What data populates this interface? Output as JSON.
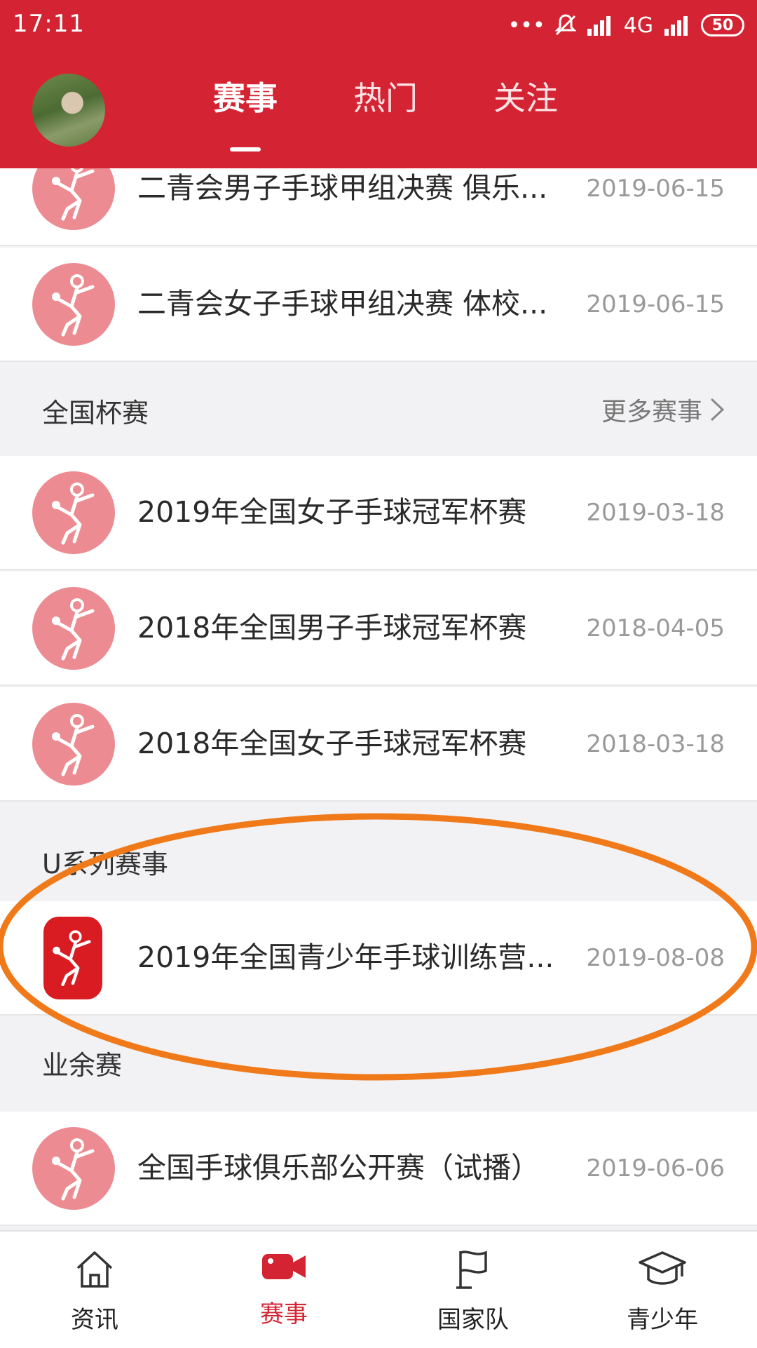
{
  "status_bar": {
    "time": "17:11",
    "network": "4G",
    "battery": "50"
  },
  "header": {
    "tabs": [
      {
        "label": "赛事",
        "active": true
      },
      {
        "label": "热门",
        "active": false
      },
      {
        "label": "关注",
        "active": false
      }
    ]
  },
  "top_rows": [
    {
      "title": "二青会男子手球甲组决赛 俱乐...",
      "date": "2019-06-15"
    },
    {
      "title": "二青会女子手球甲组决赛 体校...",
      "date": "2019-06-15"
    }
  ],
  "sections": {
    "national_cup": {
      "title": "全国杯赛",
      "more": "更多赛事",
      "rows": [
        {
          "title": "2019年全国女子手球冠军杯赛",
          "date": "2019-03-18"
        },
        {
          "title": "2018年全国男子手球冠军杯赛",
          "date": "2018-04-05"
        },
        {
          "title": "2018年全国女子手球冠军杯赛",
          "date": "2018-03-18"
        }
      ]
    },
    "u_series": {
      "title": "U系列赛事",
      "rows": [
        {
          "title": "2019年全国青少年手球训练营...",
          "date": "2019-08-08"
        }
      ]
    },
    "amateur": {
      "title": "业余赛",
      "rows": [
        {
          "title": "全国手球俱乐部公开赛（试播）",
          "date": "2019-06-06"
        }
      ]
    }
  },
  "bottom_nav": [
    {
      "label": "资讯",
      "icon": "home-icon",
      "active": false
    },
    {
      "label": "赛事",
      "icon": "video-camera-icon",
      "active": true
    },
    {
      "label": "国家队",
      "icon": "flag-icon",
      "active": false
    },
    {
      "label": "青少年",
      "icon": "graduation-cap-icon",
      "active": false
    }
  ],
  "colors": {
    "brand_red": "#d42433",
    "logo_pink": "#ec8c92",
    "logo_red": "#d91c22",
    "annotation_orange": "#f07a1a"
  }
}
